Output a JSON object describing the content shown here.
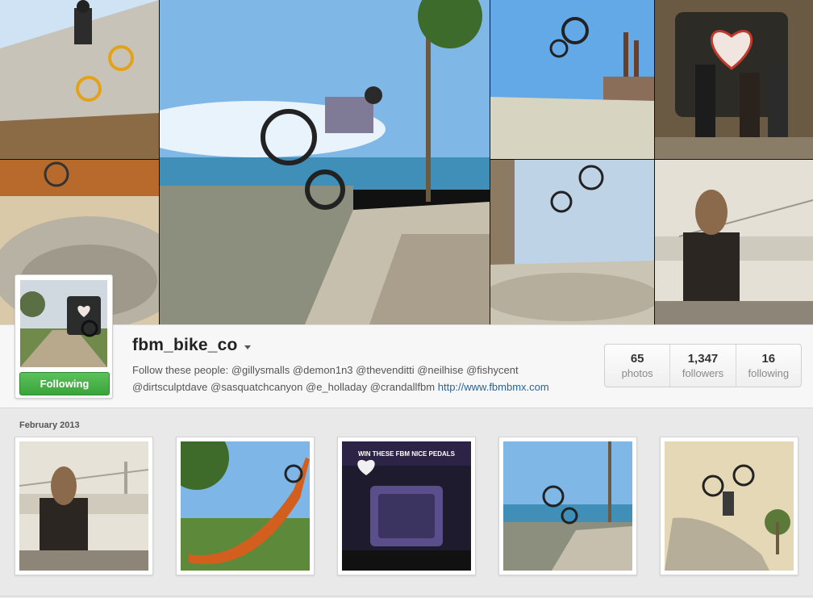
{
  "profile": {
    "username": "fbm_bike_co",
    "follow_button_label": "Following",
    "bio_text": "Follow these people: @gillysmalls @demon1n3 @thevenditti @neilhise @fishycent @dirtsculptdave @sasquatchcanyon @e_holladay @crandallfbm",
    "website": "http://www.fbmbmx.com"
  },
  "stats": [
    {
      "value": "65",
      "label": "photos"
    },
    {
      "value": "1,347",
      "label": "followers"
    },
    {
      "value": "16",
      "label": "following"
    }
  ],
  "feed": {
    "month_label": "February 2013"
  },
  "colors": {
    "follow_button": "#3aa43a",
    "link": "#2a6496"
  }
}
